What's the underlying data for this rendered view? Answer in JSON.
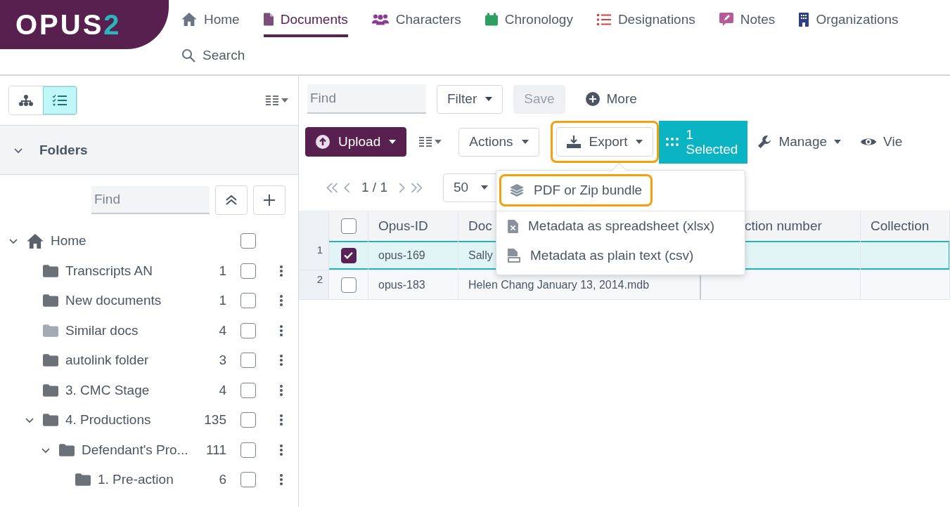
{
  "logo": {
    "text": "OPUS",
    "accent": "2"
  },
  "nav": [
    {
      "label": "Home",
      "selected": false
    },
    {
      "label": "Documents",
      "selected": true
    },
    {
      "label": "Characters",
      "selected": false
    },
    {
      "label": "Chronology",
      "selected": false
    },
    {
      "label": "Designations",
      "selected": false
    },
    {
      "label": "Notes",
      "selected": false
    },
    {
      "label": "Organizations",
      "selected": false
    },
    {
      "label": "Search",
      "selected": false
    }
  ],
  "sidebar": {
    "view_toggle": [
      {
        "selected": false
      },
      {
        "selected": true
      }
    ],
    "section_title": "Folders",
    "section_expanded": true,
    "find_placeholder": "Find",
    "tree": [
      {
        "label": "Home",
        "expanded": true,
        "checked": false,
        "children": [
          {
            "label": "Transcripts AN",
            "count": "1",
            "checked": false,
            "color": "#6b7079"
          },
          {
            "label": "New documents",
            "count": "1",
            "checked": false,
            "color": "#6b7079"
          },
          {
            "label": "Similar docs",
            "count": "4",
            "checked": false,
            "color": "#a2aab3"
          },
          {
            "label": "autolink folder",
            "count": "3",
            "checked": false,
            "color": "#6b7079"
          },
          {
            "label": "3. CMC Stage",
            "count": "4",
            "checked": false,
            "color": "#6b7079"
          },
          {
            "label": "4. Productions",
            "count": "135",
            "checked": false,
            "color": "#6b7079",
            "expanded": true,
            "children": [
              {
                "label": "Defendant's Pro...",
                "count": "111",
                "checked": false,
                "color": "#6b7079",
                "expanded": true,
                "children": [
                  {
                    "label": "1. Pre-action",
                    "count": "6",
                    "checked": false,
                    "color": "#6b7079"
                  }
                ]
              }
            ]
          }
        ]
      }
    ]
  },
  "toolbar": {
    "find_placeholder": "Find",
    "filter": "Filter",
    "save": {
      "label": "Save",
      "disabled": true
    },
    "more": "More",
    "upload": "Upload",
    "actions": "Actions",
    "export": {
      "label": "Export",
      "highlighted": true
    },
    "selected_count": "1",
    "selected_label": "Selected",
    "manage": "Manage",
    "view": "Vie"
  },
  "pager": {
    "page": "1 / 1",
    "page_size": "50"
  },
  "export_menu": [
    {
      "label": "PDF or Zip bundle",
      "highlighted": true
    },
    {
      "label": "Metadata as spreadsheet (xlsx)",
      "highlighted": false
    },
    {
      "label": "Metadata as plain text (csv)",
      "highlighted": false
    }
  ],
  "table": {
    "header_checked": false,
    "columns": [
      "Opus-ID",
      "Doc",
      "ction number",
      "Collection"
    ],
    "rows": [
      {
        "number": "1",
        "selected": true,
        "cells": [
          "opus-169",
          "Sally",
          "",
          ""
        ]
      },
      {
        "number": "2",
        "selected": false,
        "cells": [
          "opus-183",
          "Helen Chang January 13, 2014.mdb",
          "",
          ""
        ]
      }
    ]
  }
}
